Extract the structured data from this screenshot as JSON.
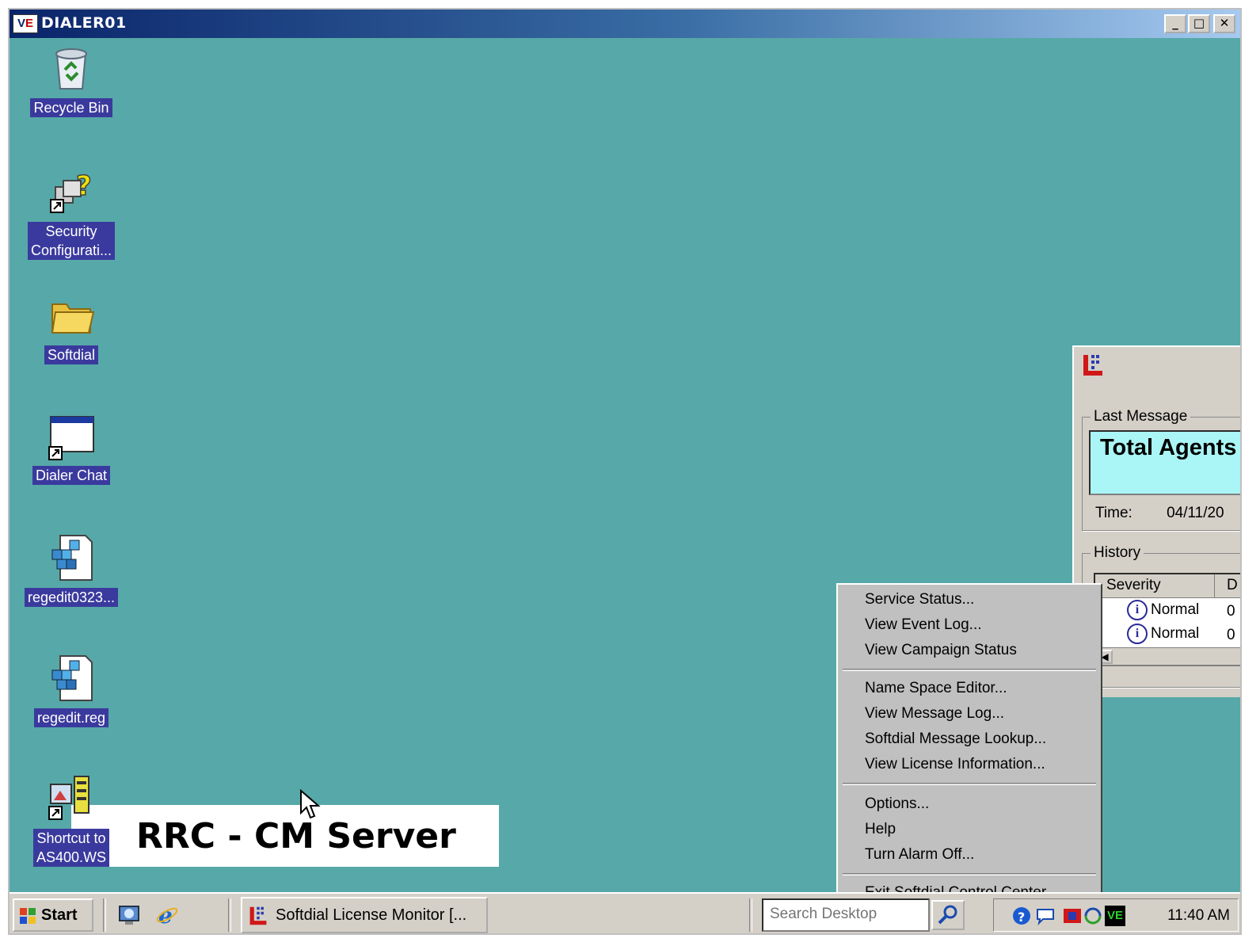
{
  "window": {
    "title": "DIALER01",
    "logo_text_a": "V",
    "logo_text_b": "E",
    "minimize_glyph": "_",
    "maximize_glyph": "□",
    "close_glyph": "✕"
  },
  "desktop_icons": [
    {
      "label": "Recycle Bin",
      "icon": "recycle-bin-icon"
    },
    {
      "label_line1": "Security",
      "label_line2": "Configurati...",
      "icon": "security-config-icon"
    },
    {
      "label": "Softdial",
      "icon": "folder-icon"
    },
    {
      "label": "Dialer Chat",
      "icon": "window-shortcut-icon"
    },
    {
      "label": "regedit0323...",
      "icon": "registry-file-icon"
    },
    {
      "label": "regedit.reg",
      "icon": "registry-file-icon"
    },
    {
      "label_line1": "Shortcut to",
      "label_line2": "AS400.WS",
      "icon": "terminal-shortcut-icon"
    }
  ],
  "banner": {
    "text": "RRC - CM Server"
  },
  "softdial_panel": {
    "last_message_title": "Last Message",
    "last_message_text": "Total Agents",
    "time_label": "Time:",
    "time_value": "04/11/20",
    "history_title": "History",
    "columns": [
      "Severity",
      "D"
    ],
    "rows": [
      {
        "severity": "Normal",
        "d": "0"
      },
      {
        "severity": "Normal",
        "d": "0"
      }
    ]
  },
  "context_menu": {
    "items": [
      "Service Status...",
      "View Event Log...",
      "View Campaign Status",
      "Name Space Editor...",
      "View Message Log...",
      "Softdial Message Lookup...",
      "View License Information...",
      "Options...",
      "Help",
      "Turn Alarm Off...",
      "Exit Softdial Control Center"
    ]
  },
  "taskbar": {
    "start_label": "Start",
    "task_label": "Softdial License Monitor [...",
    "search_placeholder": "Search Desktop",
    "clock": "11:40 AM"
  },
  "colors": {
    "desktop": "#57a8a8",
    "title_gradient_start": "#0a246a",
    "label_highlight": "#3a3a9e",
    "message_box": "#aaf5f5",
    "chrome": "#d4d0c8"
  }
}
